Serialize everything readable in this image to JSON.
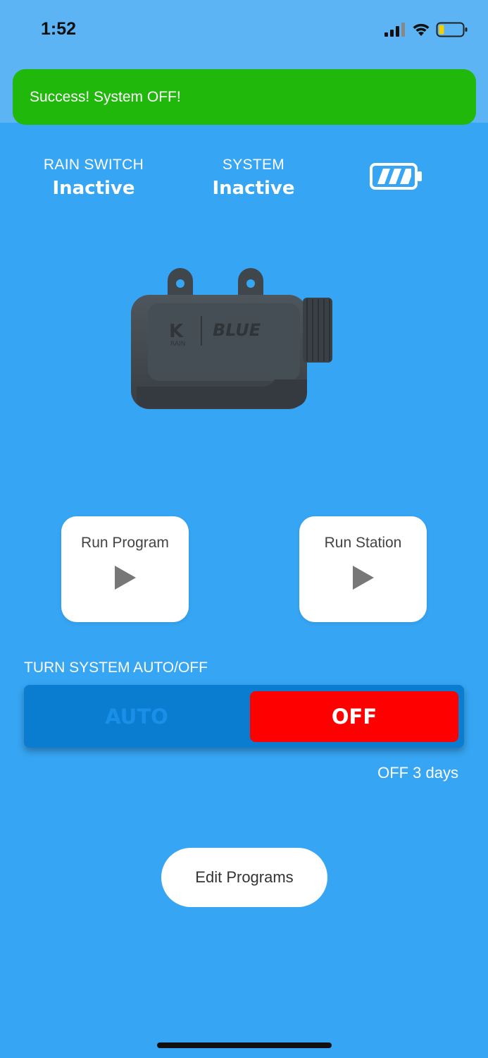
{
  "status_bar": {
    "time": "1:52"
  },
  "toast": {
    "message": "Success! System OFF!"
  },
  "rain_switch": {
    "label": "RAIN SWITCH",
    "value": "Inactive"
  },
  "system": {
    "label": "SYSTEM",
    "value": "Inactive"
  },
  "device": {
    "brand_text": "BLUE",
    "logo_text": "K",
    "logo_sub": "RAIN"
  },
  "actions": {
    "run_program": "Run Program",
    "run_station": "Run Station"
  },
  "toggle": {
    "label": "TURN SYSTEM AUTO/OFF",
    "auto": "AUTO",
    "off": "OFF",
    "selected": "OFF",
    "status": "OFF 3 days"
  },
  "edit_programs": "Edit Programs",
  "colors": {
    "background": "#36a5f3",
    "toast": "#21b80c",
    "off_active": "#ff0000",
    "toggle_track": "#0b7dd0"
  }
}
